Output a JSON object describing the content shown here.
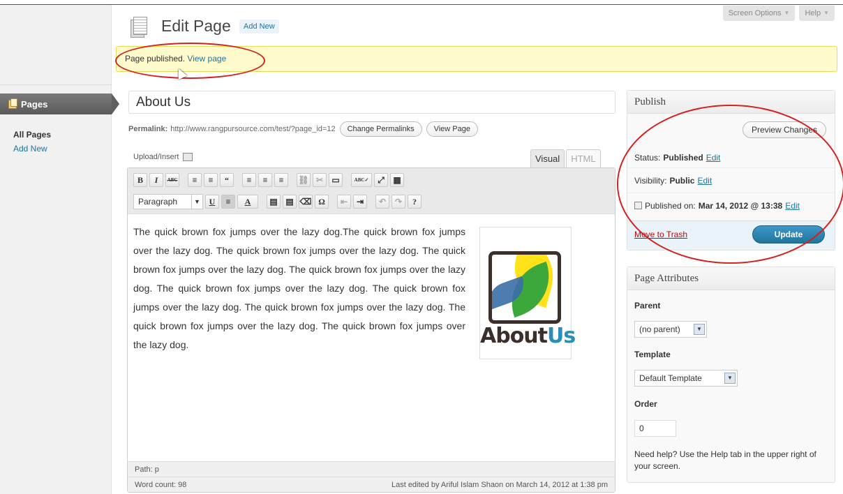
{
  "header": {
    "title": "Edit Page",
    "add_new": "Add New",
    "screen_options": "Screen Options",
    "help": "Help"
  },
  "sidebar": {
    "menu_label": "Pages",
    "items": [
      {
        "label": "All Pages",
        "current": true
      },
      {
        "label": "Add New",
        "current": false
      }
    ]
  },
  "notice": {
    "text": "Page published.",
    "link": "View page"
  },
  "editor": {
    "title_value": "About Us",
    "permalink_label": "Permalink:",
    "permalink_url": "http://www.rangpursource.com/test/?page_id=12",
    "change_permalinks": "Change Permalinks",
    "view_page": "View Page",
    "upload_insert": "Upload/Insert",
    "tab_visual": "Visual",
    "tab_html": "HTML",
    "format_select": "Paragraph",
    "toolbar_row1": [
      "B",
      "I",
      "ABC",
      "≡",
      "≡",
      "“",
      "≡",
      "≡",
      "≡",
      "⛓",
      "✂",
      "▭",
      "ABC✓",
      "⤢",
      "▦"
    ],
    "toolbar_row2": [
      "U",
      "≡",
      "A",
      "▤",
      "▤",
      "⌫",
      "Ω",
      "⇤",
      "⇥",
      "↶",
      "↷",
      "?"
    ],
    "content": "The quick brown fox jumps over the lazy dog.The quick brown fox jumps over the lazy dog. The quick brown fox jumps over the lazy dog. The quick brown fox jumps over the lazy dog. The quick brown fox jumps over the lazy dog. The quick brown fox jumps over the lazy dog. The quick brown fox jumps over the lazy dog. The quick brown fox jumps over the lazy dog. The quick brown fox jumps over the lazy dog. The quick brown fox jumps over the lazy dog.",
    "image_text_about": "About",
    "image_text_us": "Us",
    "path": "Path: p",
    "word_count": "Word count: 98",
    "last_edited": "Last edited by Ariful Islam Shaon on March 14, 2012 at 1:38 pm"
  },
  "publish": {
    "heading": "Publish",
    "preview": "Preview Changes",
    "status_label": "Status:",
    "status_value": "Published",
    "visibility_label": "Visibility:",
    "visibility_value": "Public",
    "published_on_label": "Published on:",
    "published_on_value": "Mar 14, 2012 @ 13:38",
    "edit": "Edit",
    "trash": "Move to Trash",
    "update": "Update"
  },
  "attributes": {
    "heading": "Page Attributes",
    "parent_label": "Parent",
    "parent_value": "(no parent)",
    "template_label": "Template",
    "template_value": "Default Template",
    "order_label": "Order",
    "order_value": "0",
    "help": "Need help? Use the Help tab in the upper right of your screen."
  },
  "colors": {
    "accent": "#21759b",
    "notice_bg": "#fffbcc",
    "annotation": "#d62020"
  }
}
